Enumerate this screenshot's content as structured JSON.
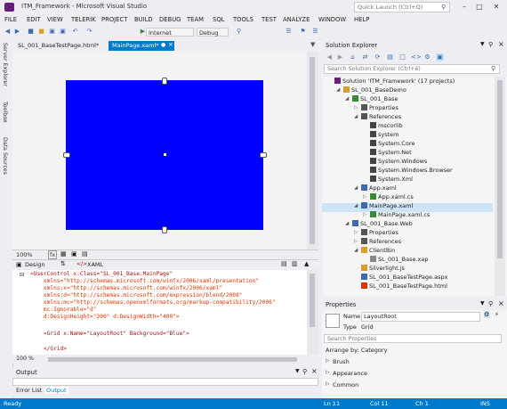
{
  "window": {
    "title": "ITM_Framework - Microsoft Visual Studio",
    "quick_launch_placeholder": "Quick Launch (Ctrl+Q)",
    "minimize": "–",
    "maximize": "□",
    "close": "✕"
  },
  "menu": [
    "FILE",
    "EDIT",
    "VIEW",
    "TELERIK",
    "PROJECT",
    "BUILD",
    "DEBUG",
    "TEAM",
    "SQL",
    "TOOLS",
    "TEST",
    "ANALYZE",
    "WINDOW",
    "HELP"
  ],
  "toolbar": {
    "browser": "Internet Explorer",
    "config": "Debug"
  },
  "left_strip": [
    "Server Explorer",
    "Toolbox",
    "Data Sources"
  ],
  "doc_tabs": [
    {
      "label": "SL_001_BaseTestPage.html*"
    },
    {
      "label": "MainPage.xaml*"
    }
  ],
  "zoom": "100%",
  "split_tabs": {
    "design": "Design",
    "xaml": "XAML"
  },
  "code_lines": [
    {
      "t": "<UserControl x:Class=\"SL_001_Base.MainPage\""
    },
    {
      "t": "    xmlns=\"http://schemas.microsoft.com/winfx/2006/xaml/presentation\""
    },
    {
      "t": "    xmlns:x=\"http://schemas.microsoft.com/winfx/2006/xaml\""
    },
    {
      "t": "    xmlns:d=\"http://schemas.microsoft.com/expression/blend/2008\""
    },
    {
      "t": "    xmlns:mc=\"http://schemas.openxmlformats.org/markup-compatibility/2006\""
    },
    {
      "t": "    mc:Ignorable=\"d\""
    },
    {
      "t": "    d:DesignHeight=\"300\" d:DesignWidth=\"400\">"
    },
    {
      "t": ""
    },
    {
      "t": "    <Grid x:Name=\"LayoutRoot\" Background=\"Blue\">"
    },
    {
      "t": ""
    },
    {
      "t": "    </Grid>"
    }
  ],
  "code_zoom": "100 %",
  "output": {
    "title": "Output",
    "tabs": [
      "Error List",
      "Output"
    ]
  },
  "solution_explorer": {
    "title": "Solution Explorer",
    "search_placeholder": "Search Solution Explorer (Ctrl+é)",
    "items": [
      {
        "label": "Solution 'ITM_Framework' (17 projects)",
        "indent": 0,
        "icon": "solution-icon",
        "arrow": ""
      },
      {
        "label": "SL_001_BaseDemo",
        "indent": 1,
        "icon": "folder-icon",
        "arrow": "◢"
      },
      {
        "label": "SL_001_Base",
        "indent": 2,
        "icon": "project-icon",
        "arrow": "◢"
      },
      {
        "label": "Properties",
        "indent": 3,
        "icon": "properties-icon",
        "arrow": "▷"
      },
      {
        "label": "References",
        "indent": 3,
        "icon": "references-icon",
        "arrow": "◢"
      },
      {
        "label": "mscorlib",
        "indent": 4,
        "icon": "reference-icon",
        "arrow": ""
      },
      {
        "label": "system",
        "indent": 4,
        "icon": "reference-icon",
        "arrow": ""
      },
      {
        "label": "System.Core",
        "indent": 4,
        "icon": "reference-icon",
        "arrow": ""
      },
      {
        "label": "System.Net",
        "indent": 4,
        "icon": "reference-icon",
        "arrow": ""
      },
      {
        "label": "System.Windows",
        "indent": 4,
        "icon": "reference-icon",
        "arrow": ""
      },
      {
        "label": "System.Windows.Browser",
        "indent": 4,
        "icon": "reference-icon",
        "arrow": ""
      },
      {
        "label": "System.Xml",
        "indent": 4,
        "icon": "reference-icon",
        "arrow": ""
      },
      {
        "label": "App.xaml",
        "indent": 3,
        "icon": "xaml-icon",
        "arrow": "◢"
      },
      {
        "label": "App.xaml.cs",
        "indent": 4,
        "icon": "cs-file-icon",
        "arrow": "▷"
      },
      {
        "label": "MainPage.xaml",
        "indent": 3,
        "icon": "xaml-icon",
        "arrow": "◢"
      },
      {
        "label": "MainPage.xaml.cs",
        "indent": 4,
        "icon": "cs-file-icon",
        "arrow": "▷"
      },
      {
        "label": "SL_001_Base.Web",
        "indent": 2,
        "icon": "web-project-icon",
        "arrow": "◢"
      },
      {
        "label": "Properties",
        "indent": 3,
        "icon": "properties-icon",
        "arrow": "▷"
      },
      {
        "label": "References",
        "indent": 3,
        "icon": "references-icon",
        "arrow": "▷"
      },
      {
        "label": "ClientBin",
        "indent": 3,
        "icon": "folder-icon",
        "arrow": "◢"
      },
      {
        "label": "SL_001_Base.xap",
        "indent": 4,
        "icon": "file-icon",
        "arrow": ""
      },
      {
        "label": "Silverlight.js",
        "indent": 3,
        "icon": "js-file-icon",
        "arrow": ""
      },
      {
        "label": "SL_001_BaseTestPage.aspx",
        "indent": 3,
        "icon": "aspx-file-icon",
        "arrow": ""
      },
      {
        "label": "SL_001_BaseTestPage.html",
        "indent": 3,
        "icon": "html-file-icon",
        "arrow": ""
      },
      {
        "label": "Web.config",
        "indent": 3,
        "icon": "config-file-icon",
        "arrow": ""
      }
    ]
  },
  "properties": {
    "title": "Properties",
    "name_label": "Name",
    "name_value": "LayoutRoot",
    "type_label": "Type",
    "type_value": "Grid",
    "search_placeholder": "Search Properties",
    "arrange_by": "Arrange by: Category",
    "categories": [
      "Brush",
      "Appearance",
      "Common"
    ]
  },
  "status": {
    "ready": "Ready",
    "line": "Ln 11",
    "col": "Col 11",
    "ch": "Ch 1",
    "ins": "INS"
  },
  "colors": {
    "accent": "#007acc",
    "design_surface": "#0000ff",
    "selection": "#cce4f7"
  }
}
